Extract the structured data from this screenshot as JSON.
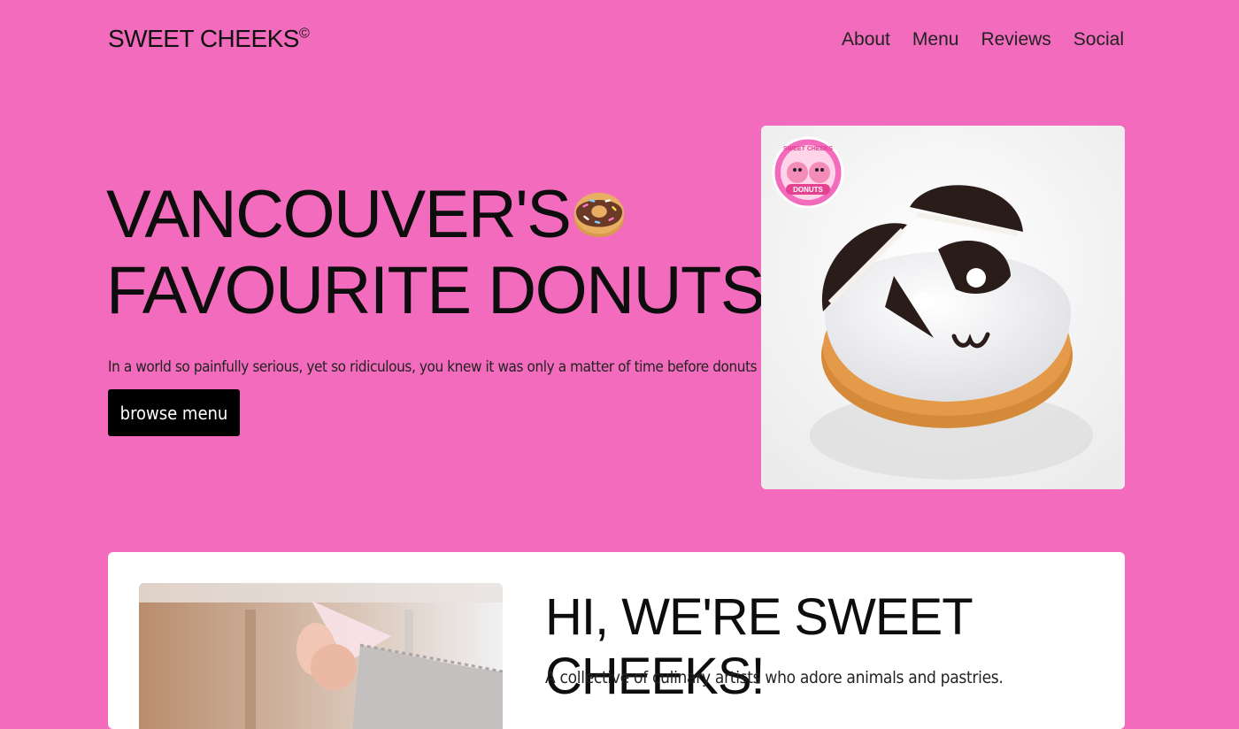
{
  "header": {
    "brand": "SWEET CHEEKS",
    "brand_mark": "©",
    "nav": [
      "About",
      "Menu",
      "Reviews",
      "Social"
    ]
  },
  "hero": {
    "title_line1": "VANCOUVER'S",
    "title_line2": "FAVOURITE DONUTS",
    "subtitle": "In a world so painfully serious, yet so ridiculous, you knew it was only a matter of time before donuts had faces.",
    "cta_label": "browse menu",
    "badge_text": [
      "SWEET CHEEKS",
      "DONUTS"
    ]
  },
  "about": {
    "title": "HI, WE'RE SWEET CHEEKS!",
    "subtitle": "A collective of culinary artists who adore animals and pastries."
  },
  "colors": {
    "background": "#f26bbd",
    "button": "#000000",
    "card": "#ffffff"
  }
}
